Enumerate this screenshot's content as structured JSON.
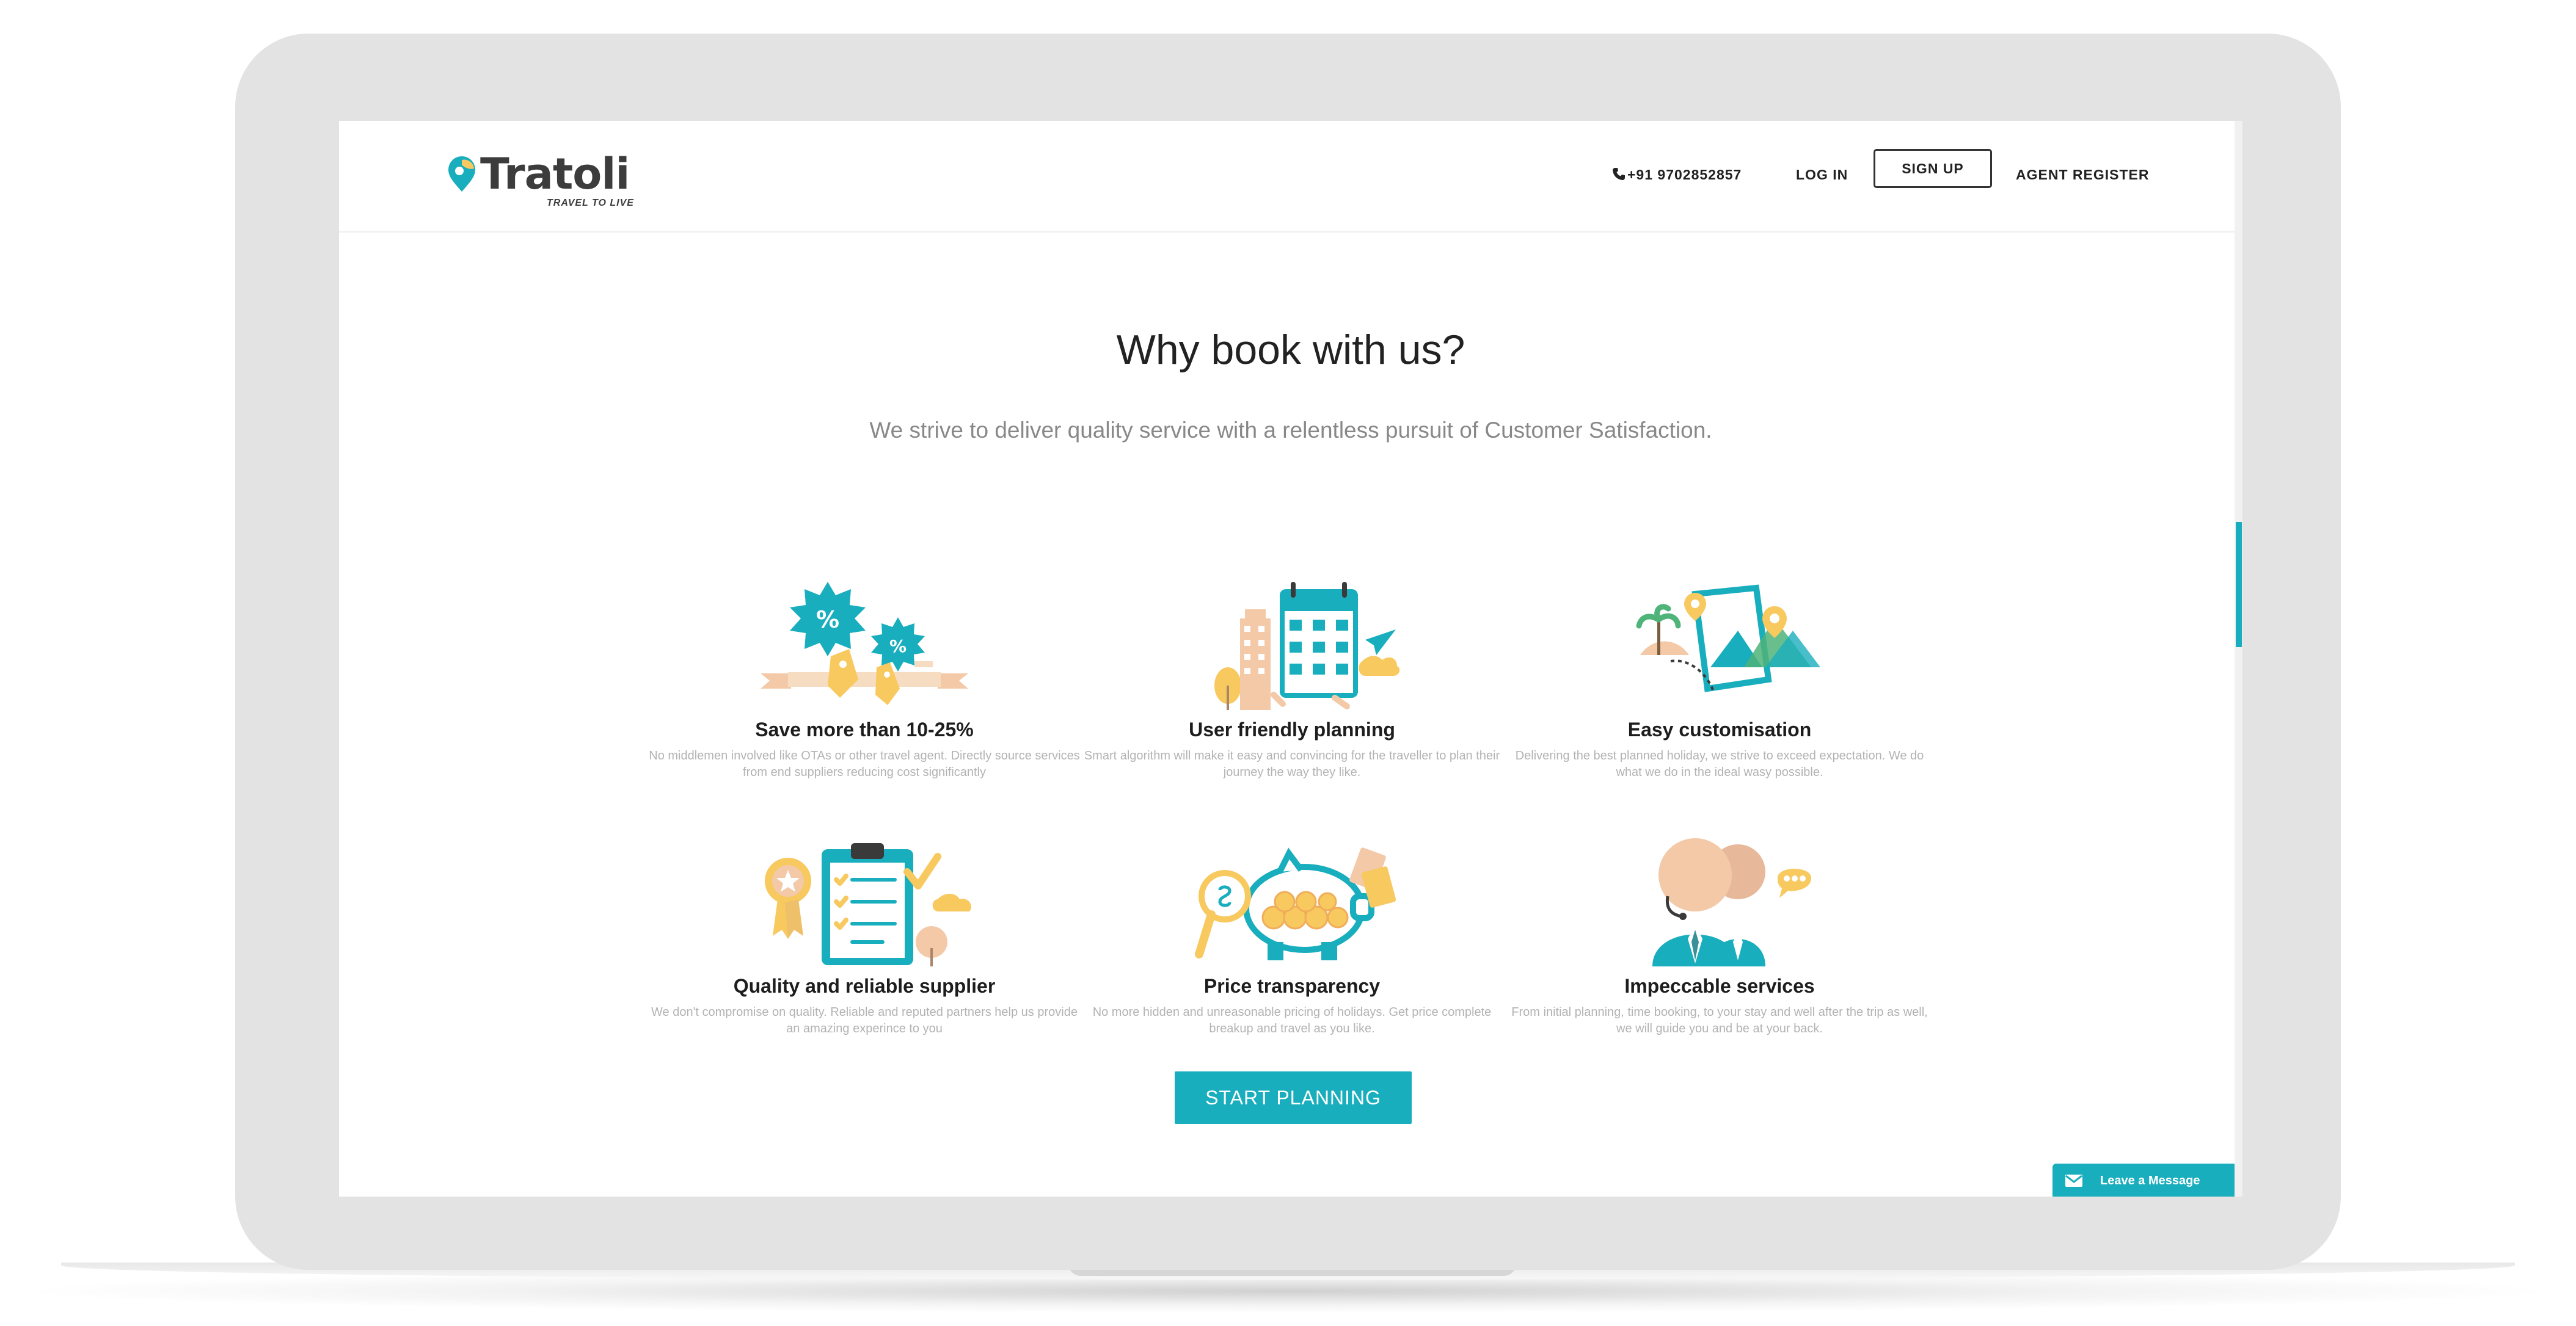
{
  "header": {
    "logo_text": "Tratoli",
    "logo_tagline": "TRAVEL TO LIVE",
    "phone": "+91 9702852857",
    "login_label": "LOG IN",
    "signup_label": "SIGN UP",
    "agent_register_label": "AGENT REGISTER"
  },
  "section": {
    "title": "Why book with us?",
    "subtitle": "We strive to deliver quality service with a relentless pursuit of Customer Satisfaction."
  },
  "features": [
    {
      "title": "Save more than 10-25%",
      "desc_line1": "No middlemen involved like OTAs or other travel agent. Directly source services",
      "desc_line2": "from end suppliers reducing cost significantly",
      "icon": "discount-tags-icon"
    },
    {
      "title": "User friendly planning",
      "desc_line1": "Smart algorithm will make it easy and convincing for the traveller to plan their",
      "desc_line2": "journey the way they like.",
      "icon": "calendar-planning-icon"
    },
    {
      "title": "Easy customisation",
      "desc_line1": "Delivering the best planned holiday, we strive to exceed expectation. We do",
      "desc_line2": "what we do in the ideal wasy possible.",
      "icon": "map-customisation-icon"
    },
    {
      "title": "Quality and reliable supplier",
      "desc_line1": "We don't compromise on quality. Reliable and reputed partners help us provide",
      "desc_line2": "an amazing experince to you",
      "icon": "checklist-award-icon"
    },
    {
      "title": "Price transparency",
      "desc_line1": "No more hidden and unreasonable pricing of holidays. Get price complete",
      "desc_line2": "breakup and travel as you like.",
      "icon": "piggy-bank-icon"
    },
    {
      "title": "Impeccable services",
      "desc_line1": "From initial planning, time booking, to your stay and well after the trip as well,",
      "desc_line2": "we will guide you and be at your back.",
      "icon": "support-agents-icon"
    }
  ],
  "cta": {
    "label": "START PLANNING"
  },
  "chat_widget": {
    "label": "Leave a Message",
    "icon": "mail-icon"
  },
  "colors": {
    "accent": "#19aebd",
    "yellow": "#f7c95f",
    "peach": "#f3c9a8",
    "frame": "#e3e3e4"
  }
}
